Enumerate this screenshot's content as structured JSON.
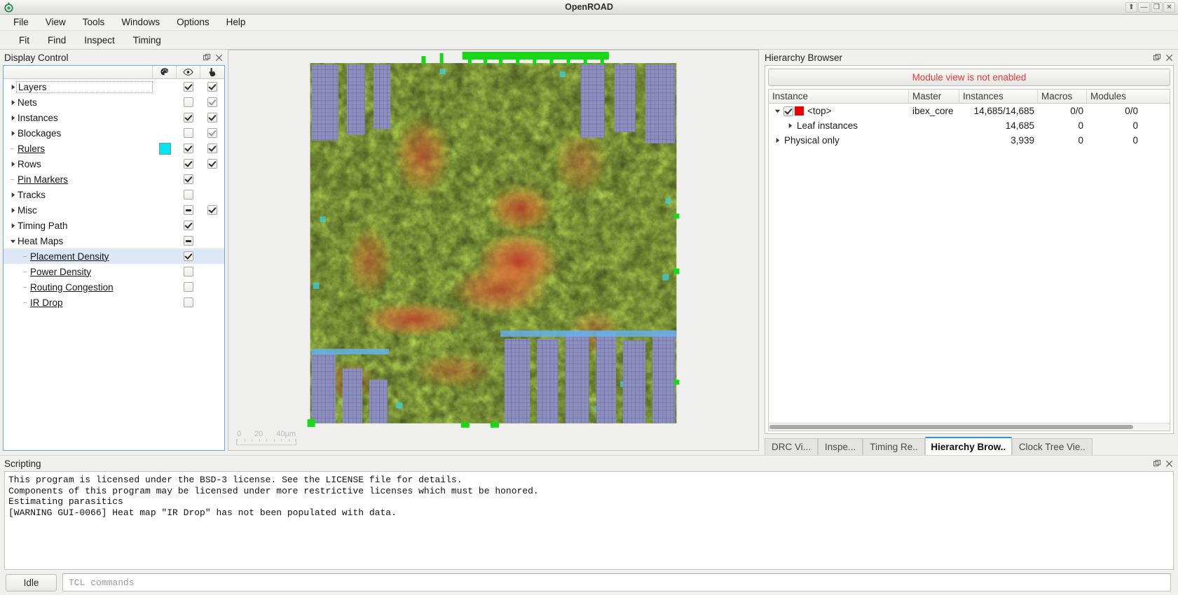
{
  "window": {
    "title": "OpenROAD",
    "controls": [
      {
        "name": "float-button",
        "glyph": "⬆"
      },
      {
        "name": "minimize-button",
        "glyph": "—"
      },
      {
        "name": "restore-button",
        "glyph": "❐"
      },
      {
        "name": "close-button",
        "glyph": "✕"
      }
    ]
  },
  "menubar": {
    "items": [
      "File",
      "View",
      "Tools",
      "Windows",
      "Options",
      "Help"
    ]
  },
  "toolbar": {
    "items": [
      "Fit",
      "Find",
      "Inspect",
      "Timing"
    ]
  },
  "display_control": {
    "title": "Display Control",
    "columns": [
      {
        "name": "color-column",
        "icon": "palette-icon"
      },
      {
        "name": "visible-column",
        "icon": "eye-icon"
      },
      {
        "name": "selectable-column",
        "icon": "cursor-icon"
      }
    ],
    "rows": [
      {
        "label": "Layers",
        "depth": 0,
        "twisty": "collapsed",
        "underline": false,
        "focus": true,
        "selected": false,
        "color": null,
        "visible": "checked",
        "selectable": "checked"
      },
      {
        "label": "Nets",
        "depth": 0,
        "twisty": "collapsed",
        "underline": false,
        "focus": false,
        "selected": false,
        "color": null,
        "visible": "unchecked",
        "selectable": "checked-light"
      },
      {
        "label": "Instances",
        "depth": 0,
        "twisty": "collapsed",
        "underline": false,
        "focus": false,
        "selected": false,
        "color": null,
        "visible": "checked",
        "selectable": "checked"
      },
      {
        "label": "Blockages",
        "depth": 0,
        "twisty": "collapsed",
        "underline": false,
        "focus": false,
        "selected": false,
        "color": null,
        "visible": "unchecked",
        "selectable": "checked-light"
      },
      {
        "label": "Rulers",
        "depth": 0,
        "twisty": "leaf",
        "underline": true,
        "focus": false,
        "selected": false,
        "color": "#00e5f0",
        "visible": "checked",
        "selectable": "checked"
      },
      {
        "label": "Rows",
        "depth": 0,
        "twisty": "collapsed",
        "underline": false,
        "focus": false,
        "selected": false,
        "color": null,
        "visible": "checked",
        "selectable": "checked"
      },
      {
        "label": "Pin Markers",
        "depth": 0,
        "twisty": "leaf",
        "underline": true,
        "focus": false,
        "selected": false,
        "color": null,
        "visible": "checked",
        "selectable": "none"
      },
      {
        "label": "Tracks",
        "depth": 0,
        "twisty": "collapsed",
        "underline": false,
        "focus": false,
        "selected": false,
        "color": null,
        "visible": "unchecked",
        "selectable": "none"
      },
      {
        "label": "Misc",
        "depth": 0,
        "twisty": "collapsed",
        "underline": false,
        "focus": false,
        "selected": false,
        "color": null,
        "visible": "partial",
        "selectable": "checked"
      },
      {
        "label": "Timing Path",
        "depth": 0,
        "twisty": "collapsed",
        "underline": false,
        "focus": false,
        "selected": false,
        "color": null,
        "visible": "checked",
        "selectable": "none"
      },
      {
        "label": "Heat Maps",
        "depth": 0,
        "twisty": "expanded",
        "underline": false,
        "focus": false,
        "selected": false,
        "color": null,
        "visible": "partial",
        "selectable": "none"
      },
      {
        "label": "Placement Density",
        "depth": 1,
        "twisty": "leaf",
        "underline": true,
        "focus": false,
        "selected": true,
        "color": null,
        "visible": "checked",
        "selectable": "none"
      },
      {
        "label": "Power Density",
        "depth": 1,
        "twisty": "leaf",
        "underline": true,
        "focus": false,
        "selected": false,
        "color": null,
        "visible": "unchecked",
        "selectable": "none"
      },
      {
        "label": "Routing Congestion",
        "depth": 1,
        "twisty": "leaf",
        "underline": true,
        "focus": false,
        "selected": false,
        "color": null,
        "visible": "unchecked",
        "selectable": "none"
      },
      {
        "label": "IR Drop",
        "depth": 1,
        "twisty": "leaf",
        "underline": true,
        "focus": false,
        "selected": false,
        "color": null,
        "visible": "unchecked",
        "selectable": "none"
      }
    ]
  },
  "viewport": {
    "scale_ruler": {
      "start": "0",
      "mid": "20",
      "end": "40µm"
    }
  },
  "hierarchy_browser": {
    "title": "Hierarchy Browser",
    "banner": "Module view is not enabled",
    "banner_color": "#e33b3b",
    "columns": [
      "Instance",
      "Master",
      "Instances",
      "Macros",
      "Modules"
    ],
    "rows": [
      {
        "instance": "<top>",
        "master": "ibex_core",
        "instances": "14,685/14,685",
        "macros": "0/0",
        "modules": "0/0",
        "depth": 0,
        "twisty": "expanded",
        "checkbox": "checked",
        "swatch": "#e90000"
      },
      {
        "instance": "Leaf instances",
        "master": "",
        "instances": "14,685",
        "macros": "0",
        "modules": "0",
        "depth": 1,
        "twisty": "collapsed",
        "checkbox": "none",
        "swatch": null
      },
      {
        "instance": "Physical only",
        "master": "",
        "instances": "3,939",
        "macros": "0",
        "modules": "0",
        "depth": 0,
        "twisty": "collapsed",
        "checkbox": "none",
        "swatch": null
      }
    ],
    "tabs": [
      {
        "label": "DRC Vi...",
        "active": false
      },
      {
        "label": "Inspe...",
        "active": false
      },
      {
        "label": "Timing Re..",
        "active": false
      },
      {
        "label": "Hierarchy Brow..",
        "active": true
      },
      {
        "label": "Clock Tree Vie..",
        "active": false
      }
    ]
  },
  "scripting": {
    "title": "Scripting",
    "lines": [
      "This program is licensed under the BSD-3 license. See the LICENSE file for details.",
      "Components of this program may be licensed under more restrictive licenses which must be honored.",
      "Estimating parasitics",
      "[WARNING GUI-0066] Heat map \"IR Drop\" has not been populated with data."
    ],
    "status": "Idle",
    "input_placeholder": "TCL commands"
  }
}
